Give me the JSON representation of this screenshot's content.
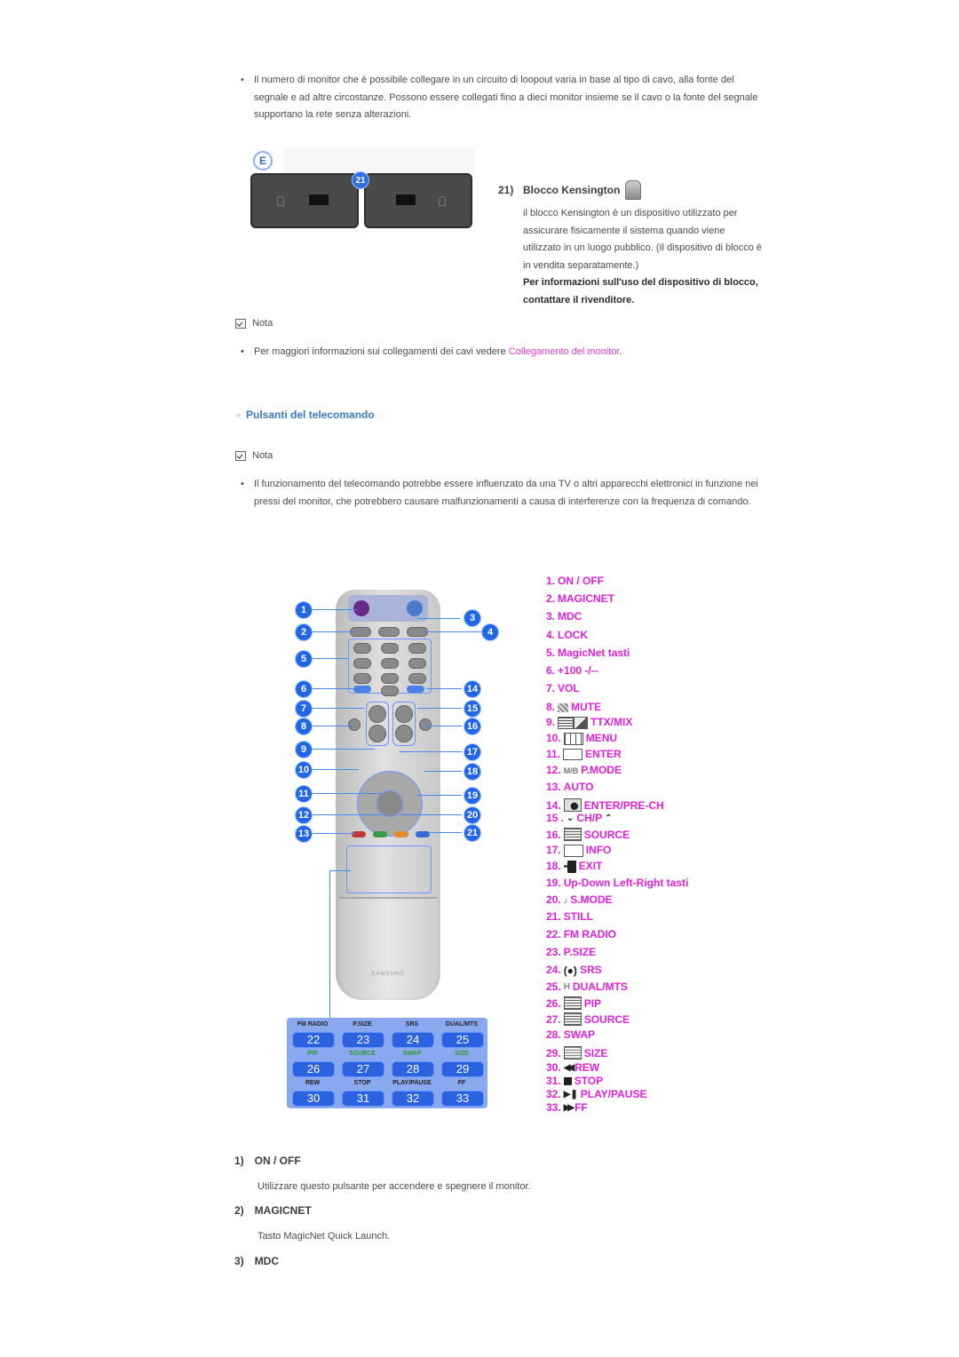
{
  "intro_bullet": "Il numero di monitor che è possibile collegare in un circuito di loopout varia in base al tipo di cavo, alla fonte del segnale e ad altre circostanze. Possono essere collegati fino a dieci monitor insieme se il cavo o la fonte del segnale supportano la rete senza alterazioni.",
  "kensington": {
    "panel_label": "E",
    "badge": "21",
    "number": "21)",
    "title": "Blocco Kensington",
    "icon": "kensington-lock-icon",
    "description": "il blocco Kensington è un dispositivo utilizzato per assicurare fisicamente il sistema quando viene utilizzato in un luogo pubblico. (Il dispositivo di blocco è in vendita separatamente.)",
    "bold_note": "Per informazioni sull'uso del dispositivo di blocco, contattare il rivenditore."
  },
  "note1": {
    "label": "Nota",
    "text_before": "Per maggiori informazioni sui collegamenti dei cavi vedere ",
    "link": "Collegamento del monitor",
    "text_after": "."
  },
  "section_title": "Pulsanti del telecomando",
  "note2": {
    "label": "Nota",
    "text": "Il funzionamento del telecomando potrebbe essere influenzato da una TV o altri apparecchi elettronici in funzione nei pressi del monitor, che potrebbero causare malfunzionamenti a causa di interferenze con la frequenza di comando."
  },
  "key_list": [
    {
      "num": "1.",
      "label": "ON / OFF",
      "icon": ""
    },
    {
      "num": "2.",
      "label": "MAGICNET",
      "icon": ""
    },
    {
      "num": "3.",
      "label": "MDC",
      "icon": ""
    },
    {
      "num": "4.",
      "label": "LOCK",
      "icon": ""
    },
    {
      "num": "5.",
      "label": "MagicNet tasti",
      "icon": ""
    },
    {
      "num": "6.",
      "label": "+100 -/--",
      "icon": ""
    },
    {
      "num": "7.",
      "label": "VOL",
      "icon": ""
    },
    {
      "num": "8.",
      "label": "MUTE",
      "icon": "mute-icon"
    },
    {
      "num": "9.",
      "label": "TTX/MIX",
      "icon": "ttx-mix-icon"
    },
    {
      "num": "10.",
      "label": "MENU",
      "icon": "menu-icon"
    },
    {
      "num": "11.",
      "label": "ENTER",
      "icon": "enter-icon"
    },
    {
      "num": "12.",
      "label": "P.MODE",
      "icon": "mb-icon"
    },
    {
      "num": "13.",
      "label": "AUTO",
      "icon": ""
    },
    {
      "num": "14.",
      "label": "ENTER/PRE-CH",
      "icon": "pre-ch-icon"
    },
    {
      "num": "15 .",
      "label": "CH/P",
      "icon": "chevron-up-down-icon"
    },
    {
      "num": "16.",
      "label": "SOURCE",
      "icon": "source-icon"
    },
    {
      "num": "17.",
      "label": "INFO",
      "icon": "info-icon"
    },
    {
      "num": "18.",
      "label": "EXIT",
      "icon": "exit-icon"
    },
    {
      "num": "19.",
      "label": "Up-Down Left-Right tasti",
      "icon": ""
    },
    {
      "num": "20.",
      "label": "S.MODE",
      "icon": "smode-icon"
    },
    {
      "num": "21.",
      "label": "STILL",
      "icon": ""
    },
    {
      "num": "22.",
      "label": "FM RADIO",
      "icon": ""
    },
    {
      "num": "23.",
      "label": "P.SIZE",
      "icon": ""
    },
    {
      "num": "24.",
      "label": "SRS",
      "icon": "srs-icon"
    },
    {
      "num": "25.",
      "label": "DUAL/MTS",
      "icon": "dual-icon"
    },
    {
      "num": "26.",
      "label": "PIP",
      "icon": "pip-icon"
    },
    {
      "num": "27.",
      "label": "SOURCE",
      "icon": "source-icon"
    },
    {
      "num": "28.",
      "label": "SWAP",
      "icon": ""
    },
    {
      "num": "29.",
      "label": "SIZE",
      "icon": "size-icon"
    },
    {
      "num": "30.",
      "label": "REW",
      "icon": "rewind-icon"
    },
    {
      "num": "31.",
      "label": "STOP",
      "icon": "stop-icon"
    },
    {
      "num": "32.",
      "label": "PLAY/PAUSE",
      "icon": "play-pause-icon"
    },
    {
      "num": "33.",
      "label": "FF",
      "icon": "fast-forward-icon"
    }
  ],
  "remote": {
    "callouts_left": [
      "1",
      "2",
      "5",
      "6",
      "7",
      "8",
      "9",
      "10",
      "11",
      "12",
      "13"
    ],
    "callouts_right": [
      "3",
      "4",
      "14",
      "15",
      "16",
      "17",
      "18",
      "19",
      "20",
      "21"
    ],
    "brand": "SAMSUNG",
    "keypad": [
      {
        "label": "FM RADIO",
        "num": "22",
        "green": false
      },
      {
        "label": "P.SIZE",
        "num": "23",
        "green": false
      },
      {
        "label": "SRS",
        "num": "24",
        "green": false
      },
      {
        "label": "DUAL/MTS",
        "num": "25",
        "green": false
      },
      {
        "label": "PIP",
        "num": "26",
        "green": true
      },
      {
        "label": "SOURCE",
        "num": "27",
        "green": true
      },
      {
        "label": "SWAP",
        "num": "28",
        "green": true
      },
      {
        "label": "SIZE",
        "num": "29",
        "green": true
      },
      {
        "label": "REW",
        "num": "30",
        "green": false
      },
      {
        "label": "STOP",
        "num": "31",
        "green": false
      },
      {
        "label": "PLAY/PAUSE",
        "num": "32",
        "green": false
      },
      {
        "label": "FF",
        "num": "33",
        "green": false
      }
    ]
  },
  "sections": [
    {
      "num": "1)",
      "title": "ON / OFF",
      "desc": "Utilizzare questo pulsante per accendere e spegnere il monitor."
    },
    {
      "num": "2)",
      "title": "MAGICNET",
      "desc": "Tasto MagicNet Quick Launch."
    },
    {
      "num": "3)",
      "title": "MDC",
      "desc": ""
    }
  ],
  "colors": {
    "accent_pink": "#e020d8",
    "link_pink": "#e838e0",
    "heading_blue": "#3a78c0"
  }
}
